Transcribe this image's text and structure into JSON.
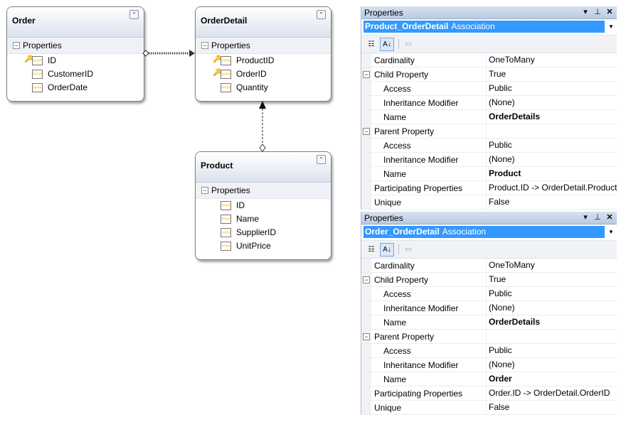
{
  "diagram": {
    "section_label": "Properties",
    "entities": {
      "order": {
        "name": "Order",
        "props": [
          "ID",
          "CustomerID",
          "OrderDate"
        ]
      },
      "orderdetail": {
        "name": "OrderDetail",
        "props": [
          "ProductID",
          "OrderID",
          "Quantity"
        ]
      },
      "product": {
        "name": "Product",
        "props": [
          "ID",
          "Name",
          "SupplierID",
          "UnitPrice"
        ]
      }
    }
  },
  "panels": [
    {
      "title": "Properties",
      "selected_name": "Product_OrderDetail",
      "selected_type": "Association",
      "rows": [
        {
          "name": "Cardinality",
          "value": "OneToMany"
        },
        {
          "name": "Child Property",
          "value": "True"
        },
        {
          "name": "Access",
          "value": "Public"
        },
        {
          "name": "Inheritance Modifier",
          "value": "(None)"
        },
        {
          "name": "Name",
          "value": "OrderDetails"
        },
        {
          "name": "Parent Property",
          "value": ""
        },
        {
          "name": "Access",
          "value": "Public"
        },
        {
          "name": "Inheritance Modifier",
          "value": "(None)"
        },
        {
          "name": "Name",
          "value": "Product"
        },
        {
          "name": "Participating Properties",
          "value": "Product.ID -> OrderDetail.ProductID"
        },
        {
          "name": "Unique",
          "value": "False"
        }
      ]
    },
    {
      "title": "Properties",
      "selected_name": "Order_OrderDetail",
      "selected_type": "Association",
      "rows": [
        {
          "name": "Cardinality",
          "value": "OneToMany"
        },
        {
          "name": "Child Property",
          "value": "True"
        },
        {
          "name": "Access",
          "value": "Public"
        },
        {
          "name": "Inheritance Modifier",
          "value": "(None)"
        },
        {
          "name": "Name",
          "value": "OrderDetails"
        },
        {
          "name": "Parent Property",
          "value": ""
        },
        {
          "name": "Access",
          "value": "Public"
        },
        {
          "name": "Inheritance Modifier",
          "value": "(None)"
        },
        {
          "name": "Name",
          "value": "Order"
        },
        {
          "name": "Participating Properties",
          "value": "Order.ID -> OrderDetail.OrderID"
        },
        {
          "name": "Unique",
          "value": "False"
        }
      ]
    }
  ]
}
